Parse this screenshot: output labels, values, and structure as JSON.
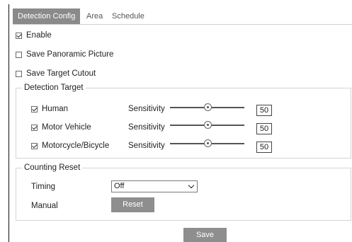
{
  "tabs": [
    {
      "label": "Detection Config",
      "active": true
    },
    {
      "label": "Area",
      "active": false
    },
    {
      "label": "Schedule",
      "active": false
    }
  ],
  "options": {
    "enable": {
      "label": "Enable",
      "checked": true
    },
    "save_panoramic": {
      "label": "Save Panoramic Picture",
      "checked": false
    },
    "save_cutout": {
      "label": "Save Target Cutout",
      "checked": false
    }
  },
  "detection_target": {
    "legend": "Detection Target",
    "items": [
      {
        "label": "Human",
        "checked": true,
        "sensitivity_label": "Sensitivity",
        "value": "50",
        "level": 0.5
      },
      {
        "label": "Motor Vehicle",
        "checked": true,
        "sensitivity_label": "Sensitivity",
        "value": "50",
        "level": 0.5
      },
      {
        "label": "Motorcycle/Bicycle",
        "checked": true,
        "sensitivity_label": "Sensitivity",
        "value": "50",
        "level": 0.5
      }
    ]
  },
  "counting_reset": {
    "legend": "Counting Reset",
    "timing_label": "Timing",
    "timing_value": "Off",
    "manual_label": "Manual",
    "reset_label": "Reset"
  },
  "save_label": "Save",
  "colors": {
    "button": "#8e8e8e",
    "active_tab": "#8a8a8a",
    "border": "#d4d4d4"
  }
}
